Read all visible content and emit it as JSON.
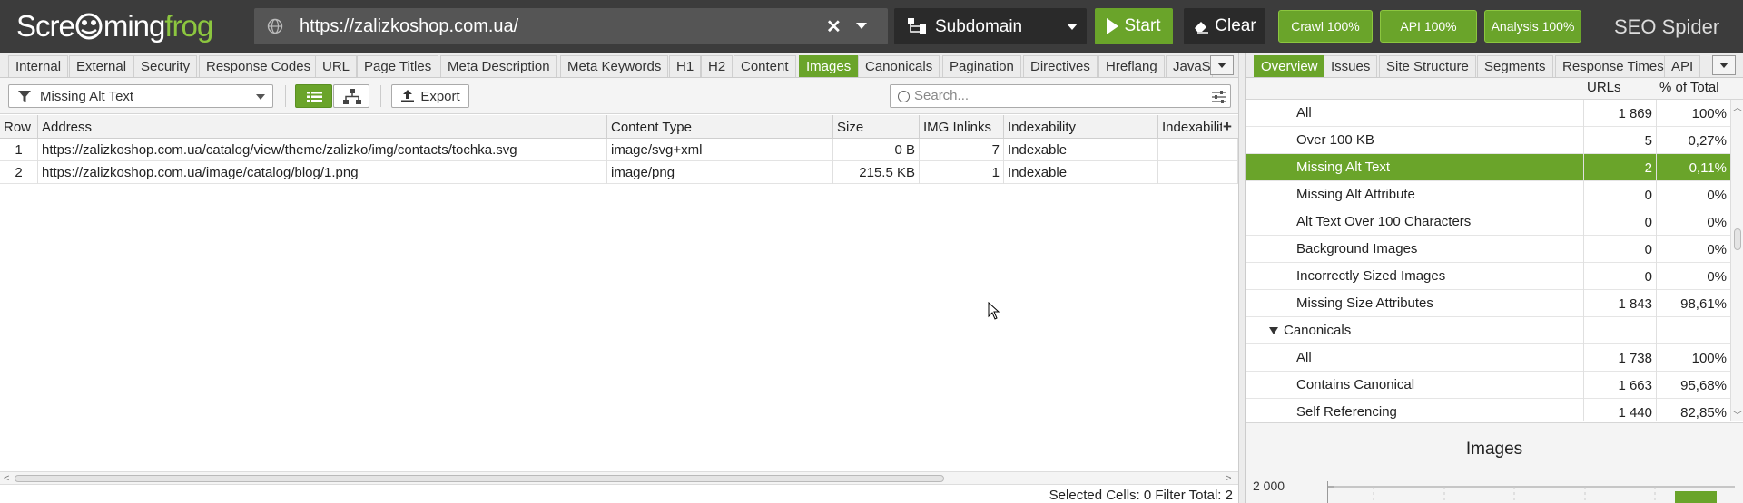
{
  "app": {
    "logo_text_1": "Scre",
    "logo_text_2": "ming",
    "logo_text_3": "frog",
    "product": "SEO Spider"
  },
  "topbar": {
    "url": "https://zalizkoshop.com.ua/",
    "mode": "Subdomain",
    "start_label": "Start",
    "clear_label": "Clear",
    "pills": [
      "Crawl 100%",
      "API 100%",
      "Analysis 100%"
    ]
  },
  "tabs_left": [
    "Internal",
    "External",
    "Security",
    "Response Codes",
    "URL",
    "Page Titles",
    "Meta Description",
    "Meta Keywords",
    "H1",
    "H2",
    "Content",
    "Images",
    "Canonicals",
    "Pagination",
    "Directives",
    "Hreflang",
    "JavaS"
  ],
  "tabs_left_active": "Images",
  "filter": {
    "selected": "Missing Alt Text",
    "export_label": "Export",
    "search_placeholder": "Search..."
  },
  "table": {
    "columns": [
      "Row",
      "Address",
      "Content Type",
      "Size",
      "IMG Inlinks",
      "Indexability",
      "Indexabilit"
    ],
    "rows": [
      [
        "1",
        "https://zalizkoshop.com.ua/catalog/view/theme/zalizko/img/contacts/tochka.svg",
        "image/svg+xml",
        "0 B",
        "7",
        "Indexable",
        ""
      ],
      [
        "2",
        "https://zalizkoshop.com.ua/image/catalog/blog/1.png",
        "image/png",
        "215.5 KB",
        "1",
        "Indexable",
        ""
      ]
    ]
  },
  "status": "Selected Cells:  0  Filter Total:  2",
  "tabs_right": [
    "Overview",
    "Issues",
    "Site Structure",
    "Segments",
    "Response Times",
    "API"
  ],
  "tabs_right_active": "Overview",
  "overview": {
    "col_urls": "URLs",
    "col_pct": "% of Total",
    "rows": [
      {
        "name": "All",
        "urls": "1 869",
        "pct": "100%",
        "indent": 2
      },
      {
        "name": "Over 100 KB",
        "urls": "5",
        "pct": "0,27%",
        "indent": 2
      },
      {
        "name": "Missing Alt Text",
        "urls": "2",
        "pct": "0,11%",
        "indent": 2,
        "selected": true
      },
      {
        "name": "Missing Alt Attribute",
        "urls": "0",
        "pct": "0%",
        "indent": 2
      },
      {
        "name": "Alt Text Over 100 Characters",
        "urls": "0",
        "pct": "0%",
        "indent": 2
      },
      {
        "name": "Background Images",
        "urls": "0",
        "pct": "0%",
        "indent": 2
      },
      {
        "name": "Incorrectly Sized Images",
        "urls": "0",
        "pct": "0%",
        "indent": 2
      },
      {
        "name": "Missing Size Attributes",
        "urls": "1 843",
        "pct": "98,61%",
        "indent": 2
      },
      {
        "name": "Canonicals",
        "urls": "",
        "pct": "",
        "indent": 1,
        "group": true
      },
      {
        "name": "All",
        "urls": "1 738",
        "pct": "100%",
        "indent": 2
      },
      {
        "name": "Contains Canonical",
        "urls": "1 663",
        "pct": "95,68%",
        "indent": 2
      },
      {
        "name": "Self Referencing",
        "urls": "1 440",
        "pct": "82,85%",
        "indent": 2
      }
    ]
  },
  "chart": {
    "title": "Images",
    "tick": "2 000"
  },
  "colors": {
    "accent": "#6aa42a",
    "topbar": "#3c3c3c"
  }
}
